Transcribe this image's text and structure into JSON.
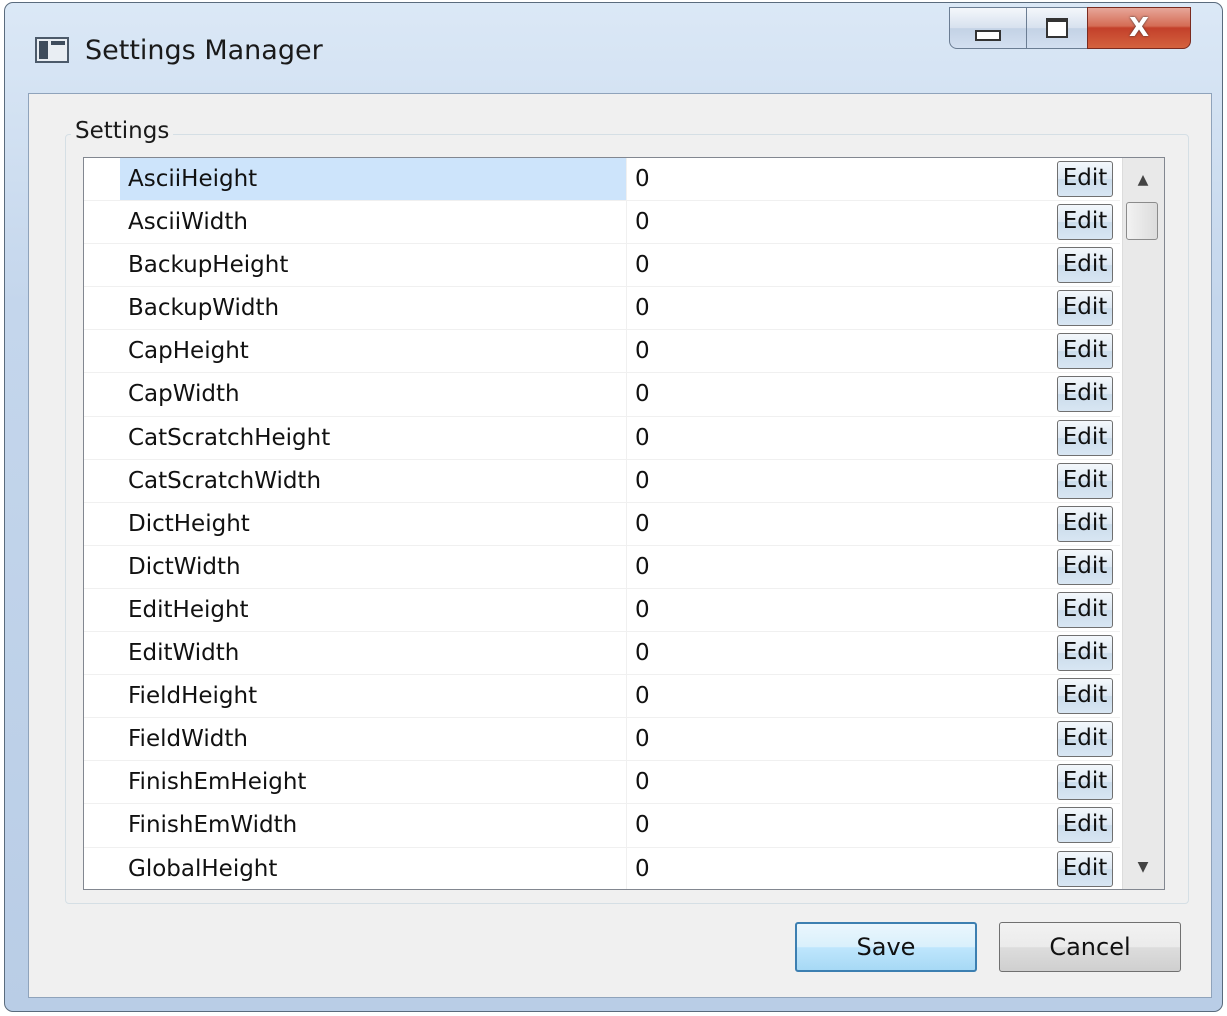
{
  "window": {
    "title": "Settings Manager",
    "close_glyph": "X"
  },
  "groupbox": {
    "label": "Settings"
  },
  "settings": [
    {
      "name": "AsciiHeight",
      "value": "0",
      "button": "Edit"
    },
    {
      "name": "AsciiWidth",
      "value": "0",
      "button": "Edit"
    },
    {
      "name": "BackupHeight",
      "value": "0",
      "button": "Edit"
    },
    {
      "name": "BackupWidth",
      "value": "0",
      "button": "Edit"
    },
    {
      "name": "CapHeight",
      "value": "0",
      "button": "Edit"
    },
    {
      "name": "CapWidth",
      "value": "0",
      "button": "Edit"
    },
    {
      "name": "CatScratchHeight",
      "value": "0",
      "button": "Edit"
    },
    {
      "name": "CatScratchWidth",
      "value": "0",
      "button": "Edit"
    },
    {
      "name": "DictHeight",
      "value": "0",
      "button": "Edit"
    },
    {
      "name": "DictWidth",
      "value": "0",
      "button": "Edit"
    },
    {
      "name": "EditHeight",
      "value": "0",
      "button": "Edit"
    },
    {
      "name": "EditWidth",
      "value": "0",
      "button": "Edit"
    },
    {
      "name": "FieldHeight",
      "value": "0",
      "button": "Edit"
    },
    {
      "name": "FieldWidth",
      "value": "0",
      "button": "Edit"
    },
    {
      "name": "FinishEmHeight",
      "value": "0",
      "button": "Edit"
    },
    {
      "name": "FinishEmWidth",
      "value": "0",
      "button": "Edit"
    },
    {
      "name": "GlobalHeight",
      "value": "0",
      "button": "Edit"
    }
  ],
  "selected_row": 0,
  "scrollbar": {
    "up_glyph": "▲",
    "down_glyph": "▼"
  },
  "footer": {
    "save_label": "Save",
    "cancel_label": "Cancel"
  },
  "colors": {
    "selection": "#cde4fb",
    "default_button_border": "#3c7fb1",
    "close_button": "#c3402a"
  }
}
